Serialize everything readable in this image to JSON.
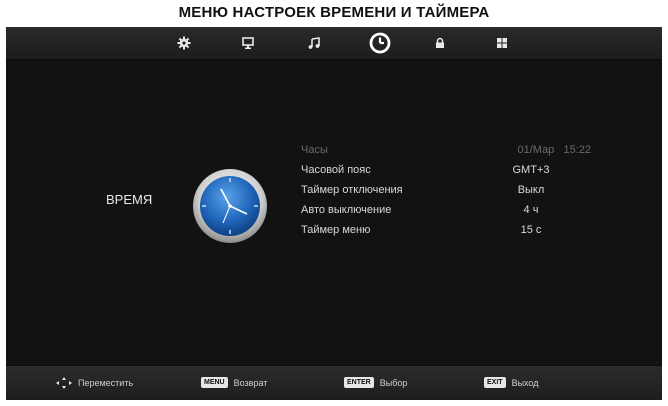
{
  "page_title": "МЕНЮ НАСТРОЕК ВРЕМЕНИ И ТАЙМЕРА",
  "tabs": [
    {
      "icon": "gear-icon",
      "active": false
    },
    {
      "icon": "monitor-icon",
      "active": false
    },
    {
      "icon": "music-note-icon",
      "active": false
    },
    {
      "icon": "clock-icon",
      "active": true
    },
    {
      "icon": "lock-icon",
      "active": false
    },
    {
      "icon": "grid-icon",
      "active": false
    }
  ],
  "section": {
    "label": "ВРЕМЯ",
    "icon": "clock-face-icon"
  },
  "menu": [
    {
      "label": "Часы",
      "value": "01/Мар   15:22",
      "dim": true
    },
    {
      "label": "Часовой пояс",
      "value": "GMT+3",
      "dim": false
    },
    {
      "label": "Таймер отключения",
      "value": "Выкл",
      "dim": false
    },
    {
      "label": "Авто выключение",
      "value": "4 ч",
      "dim": false
    },
    {
      "label": "Таймер меню",
      "value": "15 с",
      "dim": false
    }
  ],
  "bottom_hints": [
    {
      "key": "",
      "icon": "move-arrows-icon",
      "text": "Переместить"
    },
    {
      "key": "MENU",
      "text": "Возврат"
    },
    {
      "key": "ENTER",
      "text": "Выбор"
    },
    {
      "key": "EXIT",
      "text": "Выход"
    }
  ],
  "colors": {
    "screen_bg": "#141414",
    "accent_clock": "#1e63b8",
    "text": "#d8d8d8",
    "dim_text": "#6a6a6a"
  }
}
